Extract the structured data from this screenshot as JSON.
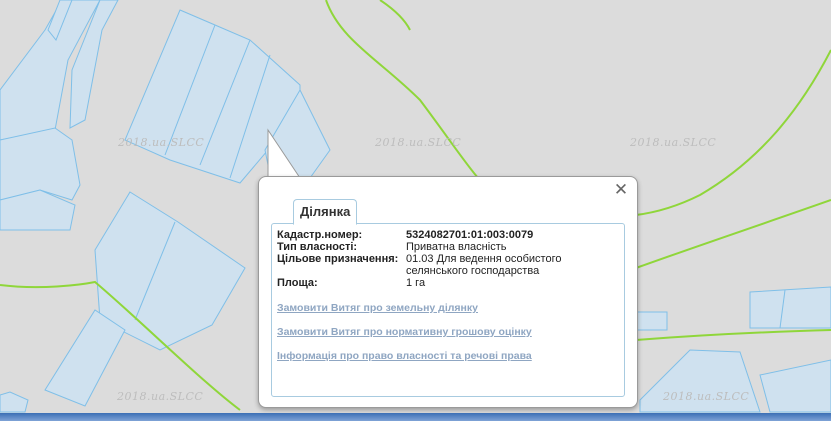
{
  "map": {
    "watermark_text": "2018.ua.SLCC",
    "parcel_fill": "#cfe1ef",
    "parcel_stroke": "#7fbfe8",
    "road_color": "#8fd63a"
  },
  "popup": {
    "tab_label": "Ділянка",
    "close_symbol": "✕",
    "fields": {
      "cadastral_label": "Кадастр.номер:",
      "cadastral_value": "5324082701:01:003:0079",
      "ownership_label": "Тип власності:",
      "ownership_value": "Приватна власність",
      "purpose_label": "Цільове призначення:",
      "purpose_value": "01.03 Для ведення особистого селянського господарства",
      "area_label": "Площа:",
      "area_value": "1 га"
    },
    "links": {
      "extract_parcel": "Замовити Витяг про земельну ділянку",
      "extract_valuation": "Замовити Витяг про нормативну грошову оцінку",
      "ownership_info": "Інформація про право власності та речові права"
    }
  }
}
